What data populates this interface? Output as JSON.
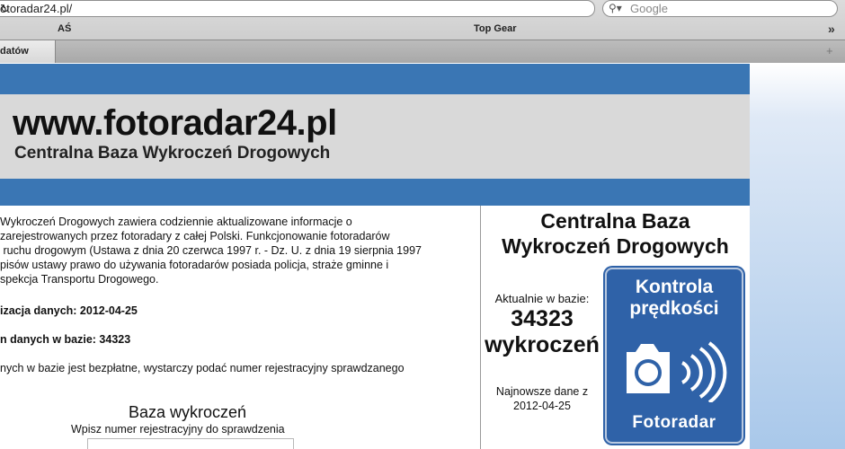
{
  "browser": {
    "url": "otoradar24.pl/",
    "search_placeholder": "Google",
    "bookmarks": [
      "AŚ",
      "Top Gear"
    ],
    "tab_label": "datów"
  },
  "header": {
    "site_title": "www.fotoradar24.pl",
    "site_subtitle": "Centralna Baza Wykroczeń Drogowych"
  },
  "main": {
    "intro_lines": [
      "Wykroczeń Drogowych zawiera codziennie aktualizowane informacje o",
      "zarejestrowanych przez fotoradary z całej Polski. Funkcjonowanie fotoradarów",
      " ruchu drogowym (Ustawa z dnia 20 czerwca 1997 r. - Dz. U. z dnia 19 sierpnia 1997",
      "pisów ustawy prawo do używania fotoradarów posiada policja, straże gminne i",
      "spekcja Transportu Drogowego."
    ],
    "update_line": "izacja danych: 2012-04-25",
    "count_line": "n danych w bazie: 34323",
    "note": "nych w bazie jest bezpłatne, wystarczy podać numer rejestracyjny sprawdzanego",
    "search_title": "Baza wykroczeń",
    "search_hint": "Wpisz numer rejestracyjny do sprawdzenia",
    "plate_value": ""
  },
  "sidebar": {
    "title_line1": "Centralna Baza",
    "title_line2": "Wykroczeń Drogowych",
    "count_label": "Aktualnie w bazie:",
    "count_value": "34323",
    "count_unit": "wykroczeń",
    "newest_label": "Najnowsze dane z",
    "newest_date": "2012-04-25",
    "sign": {
      "line1": "Kontrola",
      "line2": "prędkości",
      "line3": "Fotoradar",
      "icon": "speed-camera-icon",
      "color": "#2f62a8"
    }
  },
  "colors": {
    "brand_blue": "#3a76b4",
    "header_gray": "#d9d9d9"
  }
}
